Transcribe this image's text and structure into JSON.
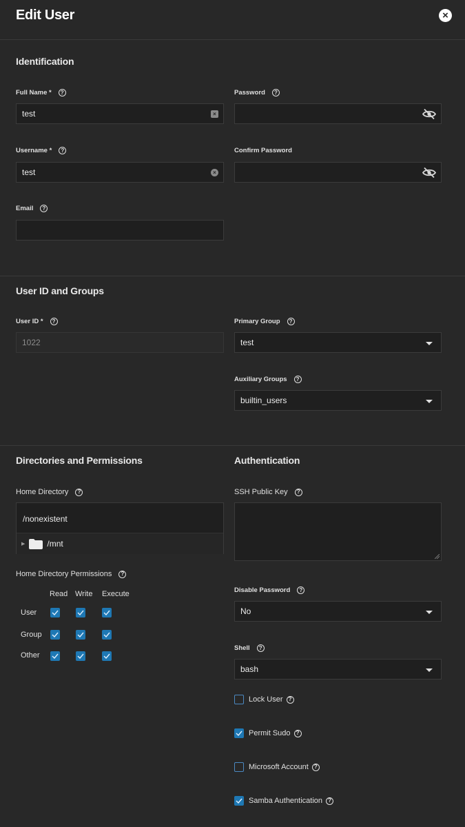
{
  "header": {
    "title": "Edit User",
    "close_glyph": "×"
  },
  "identification": {
    "section_title": "Identification",
    "full_name": {
      "label": "Full Name *",
      "value": "test"
    },
    "username": {
      "label": "Username *",
      "value": "test"
    },
    "email": {
      "label": "Email",
      "value": ""
    },
    "password": {
      "label": "Password",
      "value": ""
    },
    "confirm_password": {
      "label": "Confirm Password",
      "value": ""
    }
  },
  "user_id_groups": {
    "section_title": "User ID and Groups",
    "user_id": {
      "label": "User ID *",
      "value": "1022"
    },
    "primary_group": {
      "label": "Primary Group",
      "value": "test"
    },
    "auxiliary_groups": {
      "label": "Auxiliary Groups",
      "value": "builtin_users"
    }
  },
  "directories": {
    "section_title": "Directories and Permissions",
    "home_directory": {
      "label": "Home Directory",
      "path": "/nonexistent",
      "tree_item": "/mnt"
    },
    "permissions": {
      "label": "Home Directory Permissions",
      "columns": [
        "Read",
        "Write",
        "Execute"
      ],
      "rows": [
        {
          "name": "User",
          "read": true,
          "write": true,
          "execute": true
        },
        {
          "name": "Group",
          "read": true,
          "write": true,
          "execute": true
        },
        {
          "name": "Other",
          "read": true,
          "write": true,
          "execute": true
        }
      ]
    }
  },
  "authentication": {
    "section_title": "Authentication",
    "ssh_public_key": {
      "label": "SSH Public Key",
      "value": ""
    },
    "disable_password": {
      "label": "Disable Password",
      "value": "No"
    },
    "shell": {
      "label": "Shell",
      "value": "bash"
    },
    "lock_user": {
      "label": "Lock User",
      "checked": false
    },
    "permit_sudo": {
      "label": "Permit Sudo",
      "checked": true
    },
    "microsoft_account": {
      "label": "Microsoft Account",
      "checked": false
    },
    "samba_authentication": {
      "label": "Samba Authentication",
      "checked": true
    }
  },
  "icons": {
    "help": "?",
    "clear": "×",
    "tree_arrow": "▶"
  },
  "colors": {
    "background": "#282828",
    "field": "#1f1f1f",
    "checkbox_accent": "#1e78b4"
  }
}
